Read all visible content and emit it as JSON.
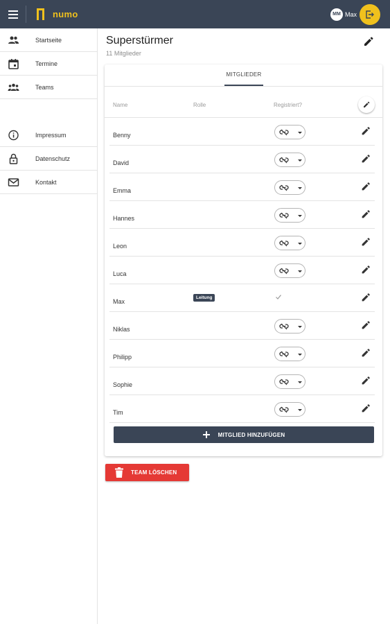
{
  "app": {
    "logo_text": "numo",
    "user_initials": "MM",
    "user_name": "Max",
    "brand_color": "#f0c11d",
    "primary_color": "#3a4556",
    "danger_color": "#e53935"
  },
  "sidebar": {
    "items": [
      {
        "label": "Startseite",
        "icon": "people-icon"
      },
      {
        "label": "Termine",
        "icon": "calendar-icon"
      },
      {
        "label": "Teams",
        "icon": "groups-icon"
      },
      {
        "label": "Impressum",
        "icon": "info-icon"
      },
      {
        "label": "Datenschutz",
        "icon": "lock-icon"
      },
      {
        "label": "Kontakt",
        "icon": "mail-icon"
      }
    ]
  },
  "team": {
    "title": "Superstürmer",
    "subtitle": "11 Mitglieder"
  },
  "tabs": {
    "members": "MITGLIEDER"
  },
  "table": {
    "headers": {
      "name": "Name",
      "role": "Rolle",
      "registered": "Registriert?"
    },
    "rows": [
      {
        "name": "Benny",
        "role": "",
        "registered": false
      },
      {
        "name": "David",
        "role": "",
        "registered": false
      },
      {
        "name": "Emma",
        "role": "",
        "registered": false
      },
      {
        "name": "Hannes",
        "role": "",
        "registered": false
      },
      {
        "name": "Leon",
        "role": "",
        "registered": false
      },
      {
        "name": "Luca",
        "role": "",
        "registered": false
      },
      {
        "name": "Max",
        "role": "Leitung",
        "registered": true
      },
      {
        "name": "Niklas",
        "role": "",
        "registered": false
      },
      {
        "name": "Philipp",
        "role": "",
        "registered": false
      },
      {
        "name": "Sophie",
        "role": "",
        "registered": false
      },
      {
        "name": "Tim",
        "role": "",
        "registered": false
      }
    ]
  },
  "actions": {
    "add_member": "MITGLIED HINZUFÜGEN",
    "delete_team": "TEAM LÖSCHEN"
  }
}
